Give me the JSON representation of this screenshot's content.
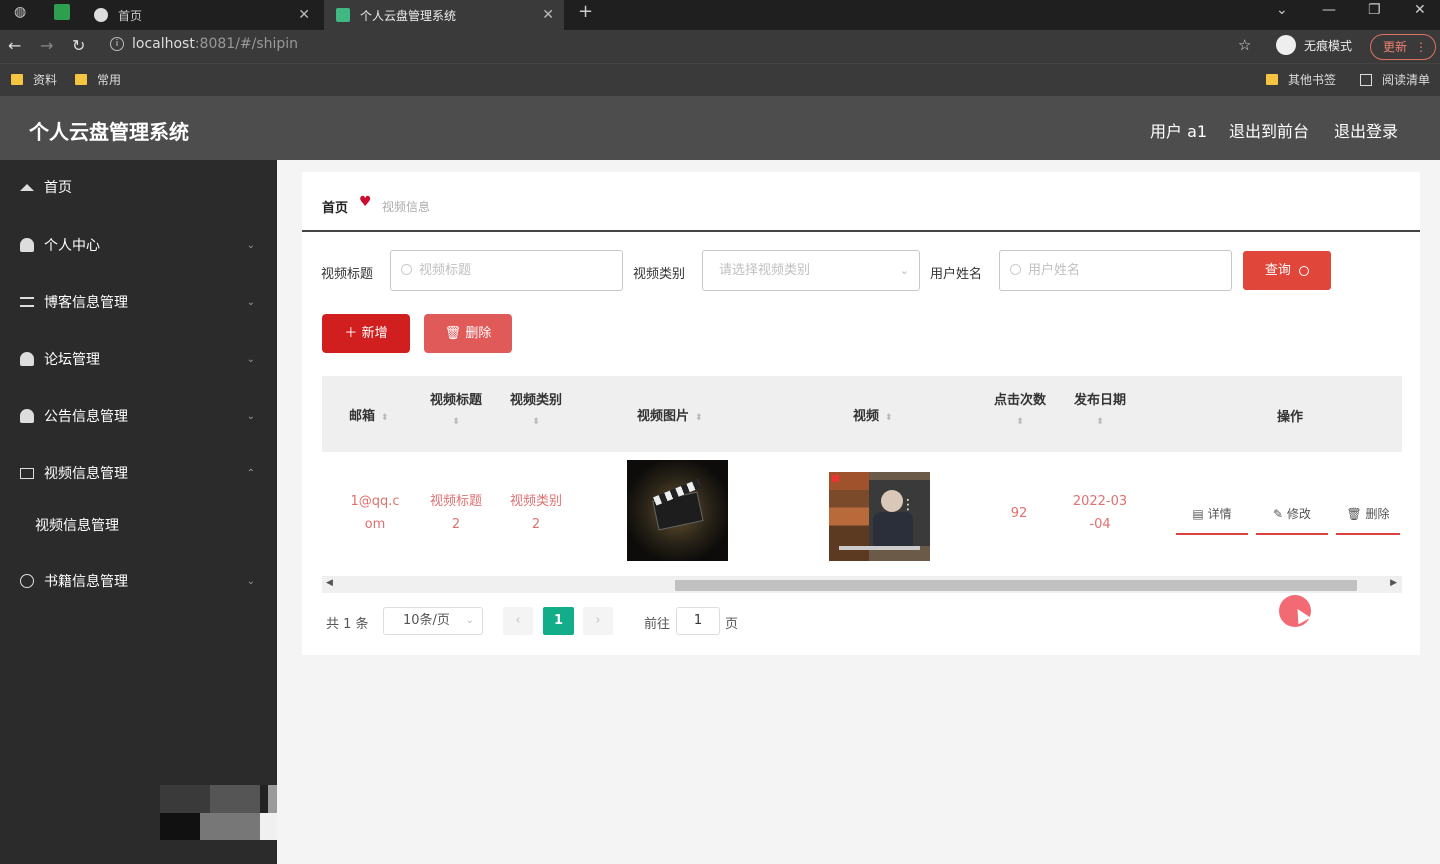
{
  "browser": {
    "tabs": [
      {
        "label": "首页",
        "active": false
      },
      {
        "label": "个人云盘管理系统",
        "active": true
      }
    ],
    "new_tab": "+",
    "url_host": "localhost",
    "url_rest": ":8081/#/shipin",
    "incognito_label": "无痕模式",
    "update_label": "更新",
    "bookmarks": [
      "资料",
      "常用"
    ],
    "other_bookmarks": "其他书签",
    "reading_list": "阅读清单"
  },
  "header": {
    "title": "个人云盘管理系统",
    "user": "用户 a1",
    "back_front": "退出到前台",
    "logout": "退出登录"
  },
  "sidebar": {
    "items": [
      {
        "label": "首页"
      },
      {
        "label": "个人中心"
      },
      {
        "label": "博客信息管理"
      },
      {
        "label": "论坛管理"
      },
      {
        "label": "公告信息管理"
      },
      {
        "label": "视频信息管理"
      },
      {
        "label": "书籍信息管理"
      }
    ],
    "sub_item": "视频信息管理"
  },
  "breadcrumb": {
    "home": "首页",
    "current": "视频信息"
  },
  "filters": {
    "title_label": "视频标题",
    "title_placeholder": "视频标题",
    "category_label": "视频类别",
    "category_placeholder": "请选择视频类别",
    "user_label": "用户姓名",
    "user_placeholder": "用户姓名",
    "search_button": "查询"
  },
  "actions": {
    "add": "新增",
    "delete": "删除"
  },
  "table": {
    "columns": [
      "邮箱",
      "视频标题",
      "视频类别",
      "视频图片",
      "视频",
      "点击次数",
      "发布日期",
      "操作"
    ],
    "rows": [
      {
        "email_line1": "1@qq.c",
        "email_line2": "om",
        "title_line1": "视频标题",
        "title_line2": "2",
        "category_line1": "视频类别",
        "category_line2": "2",
        "clicks": "92",
        "date_line1": "2022-03",
        "date_line2": "-04",
        "ops": {
          "detail": "详情",
          "edit": "修改",
          "delete": "删除"
        }
      }
    ]
  },
  "pagination": {
    "total": "共 1 条",
    "page_size": "10条/页",
    "current_page": "1",
    "goto_label": "前往",
    "goto_value": "1",
    "page_unit": "页"
  },
  "colors": {
    "primary_red": "#d11f1f",
    "search_red": "#e0463a",
    "active_page": "#13ad8a",
    "sidebar_bg": "#2b2b2b",
    "header_bg": "#4d4d4d"
  }
}
